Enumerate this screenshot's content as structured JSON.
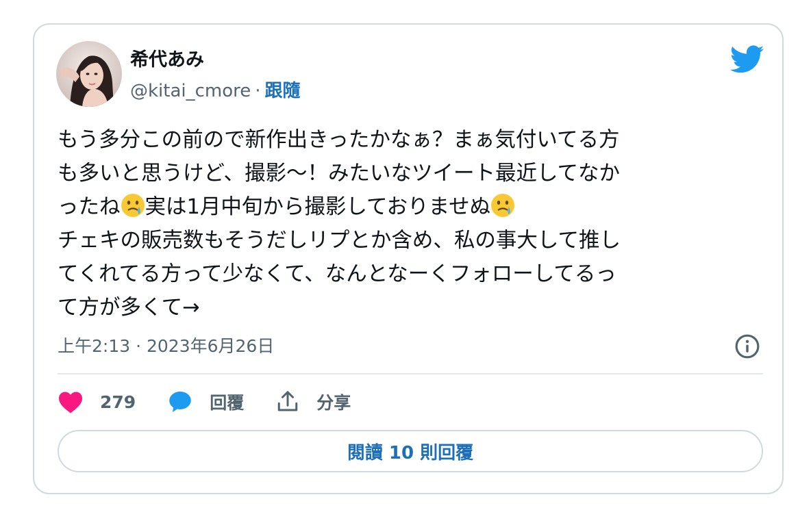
{
  "tweet": {
    "display_name": "希代あみ",
    "handle": "@kitai_cmore",
    "separator": "·",
    "follow_label": "跟隨",
    "text_lines": [
      "もう多分この前ので新作出きったかなぁ？まぁ気付いてる方",
      "も多いと思うけど、撮影〜！みたいなツイート最近してなか",
      "ったね",
      "実は1月中旬から撮影しておりませぬ",
      "チェキの販売数もそうだしリプとか含め、私の事大して推し",
      "てくれてる方って少なくて、なんとなーくフォローしてるっ",
      "て方が多くて→"
    ],
    "timestamp": "上午2:13 · 2023年6月26日",
    "likes": "279",
    "reply_label": "回覆",
    "share_label": "分享",
    "read_replies_label": "閱讀 10 則回覆"
  },
  "icons": {
    "brand": "twitter-bird-icon",
    "emoji": "face-holding-back-tears-emoji",
    "info": "info-icon",
    "like": "heart-icon",
    "reply": "speech-bubble-icon",
    "share": "share-upload-icon"
  },
  "colors": {
    "twitter_blue": "#1d9bf0",
    "link_blue": "#1d70b8",
    "like_pink": "#f91880",
    "secondary_text": "#536471",
    "border": "#cfd9de"
  }
}
